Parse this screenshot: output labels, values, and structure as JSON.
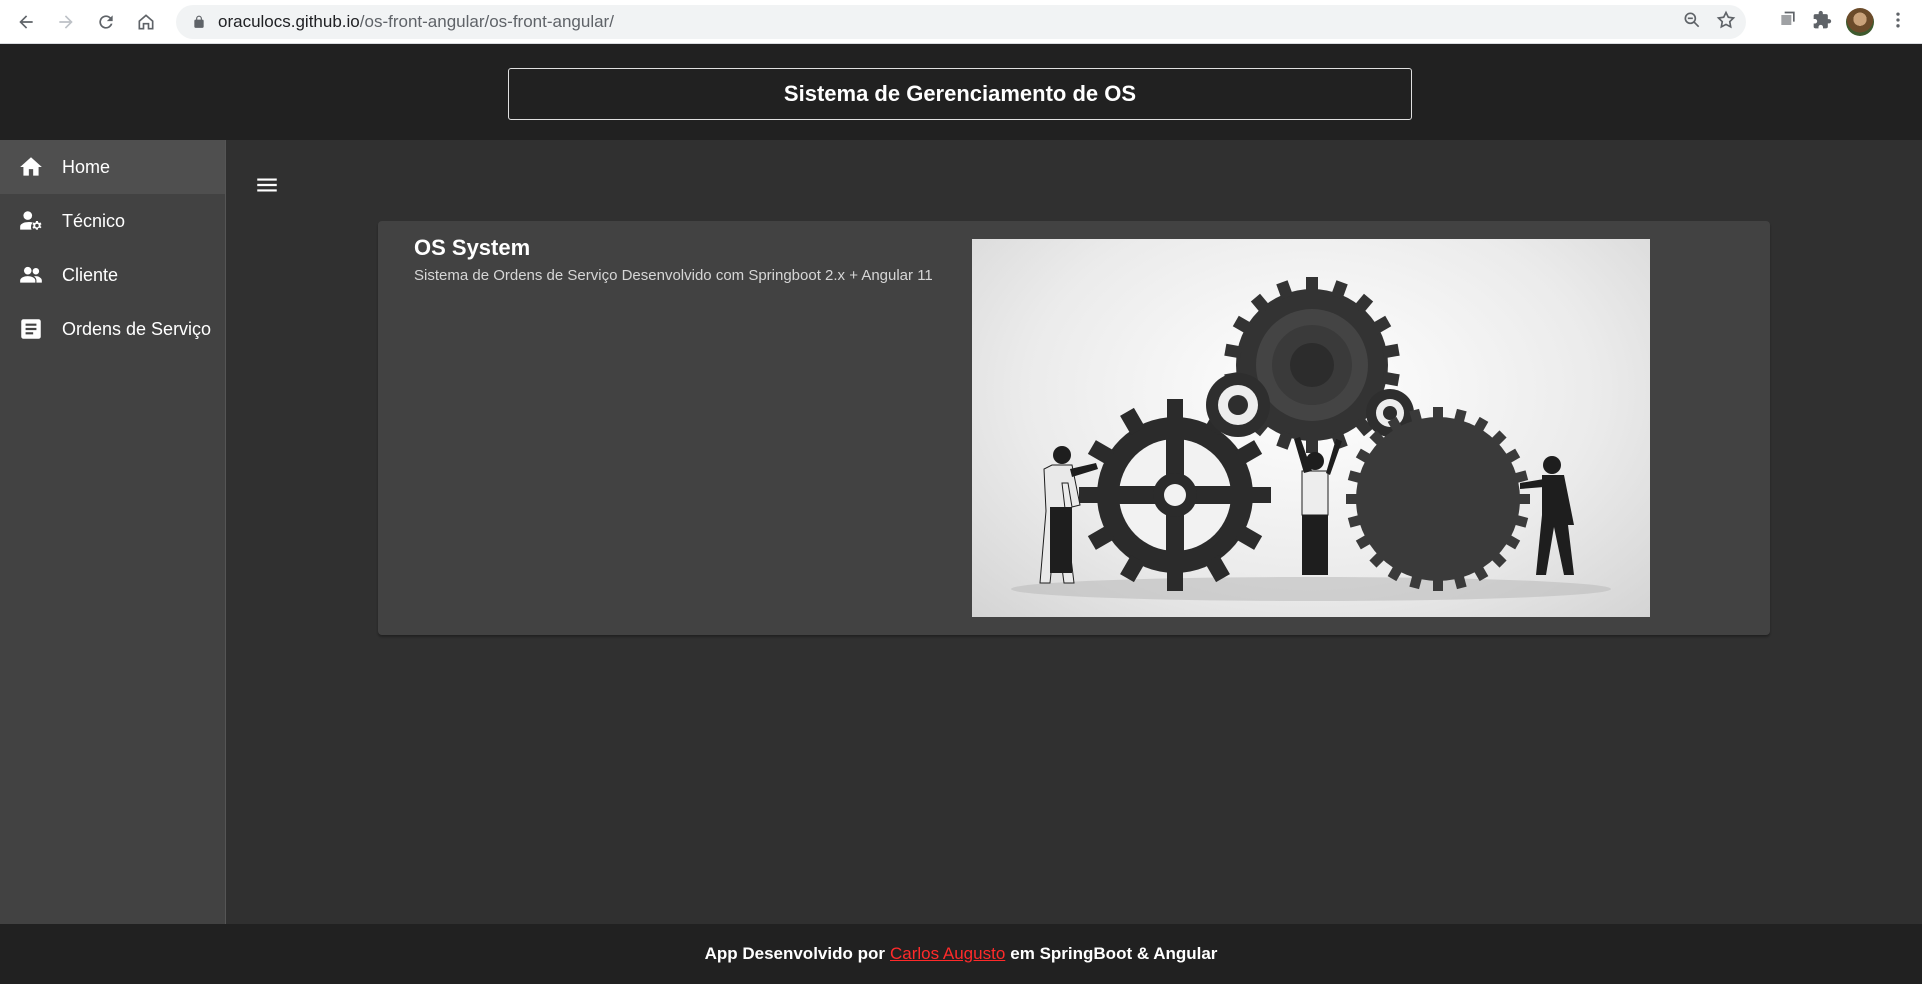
{
  "browser": {
    "url_host": "oraculocs.github.io",
    "url_path": "/os-front-angular/os-front-angular/",
    "icons": [
      "back-icon",
      "forward-icon",
      "reload-icon",
      "home-icon",
      "lock-icon",
      "zoom-icon",
      "star-icon",
      "tab-search-icon",
      "extensions-icon",
      "profile-avatar",
      "more-icon"
    ]
  },
  "header": {
    "title": "Sistema de Gerenciamento de OS"
  },
  "sidebar": {
    "items": [
      {
        "label": "Home",
        "icon": "home-icon",
        "active": true
      },
      {
        "label": "Técnico",
        "icon": "technician-icon",
        "active": false
      },
      {
        "label": "Cliente",
        "icon": "people-icon",
        "active": false
      },
      {
        "label": "Ordens de Serviço",
        "icon": "document-icon",
        "active": false
      }
    ]
  },
  "main": {
    "menu_icon": "menu-icon",
    "card": {
      "title": "OS System",
      "subtitle": "Sistema de Ordens de Serviço Desenvolvido com Springboot 2.x + Angular 11",
      "image": "gears-teamwork-image"
    }
  },
  "footer": {
    "prefix": "App Desenvolvido por",
    "author": "Carlos Augusto",
    "suffix": "em SpringBoot & Angular",
    "link_color": "#ff2a2a"
  },
  "colors": {
    "header_bg": "#212121",
    "sidebar_bg": "#424242",
    "content_bg": "#303030",
    "card_bg": "#424242"
  }
}
